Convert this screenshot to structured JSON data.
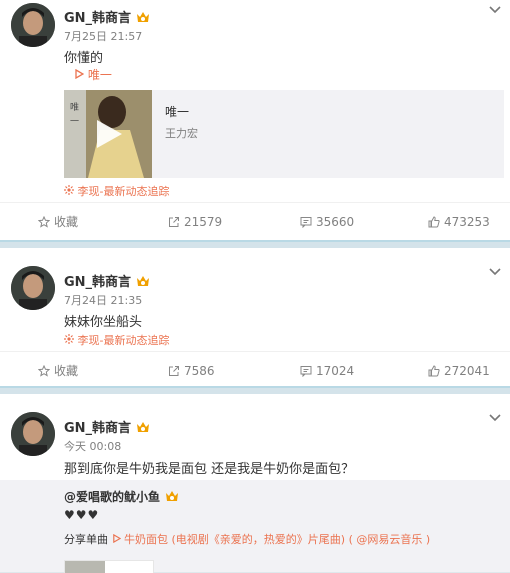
{
  "posts": [
    {
      "username": "GN_韩商言",
      "time": "7月25日 21:57",
      "text": "你懂的",
      "music_link": "唯一",
      "media": {
        "title": "唯一",
        "artist": "王力宏"
      },
      "source": "李现-最新动态追踪",
      "actions": {
        "favorite": "收藏",
        "share": "21579",
        "comment": "35660",
        "like": "473253"
      }
    },
    {
      "username": "GN_韩商言",
      "time": "7月24日 21:35",
      "text": "妹妹你坐船头",
      "source": "李现-最新动态追踪",
      "actions": {
        "favorite": "收藏",
        "share": "7586",
        "comment": "17024",
        "like": "272041"
      }
    },
    {
      "username": "GN_韩商言",
      "time": "今天 00:08",
      "text": "那到底你是牛奶我是面包 还是我是牛奶你是面包？",
      "quote": {
        "username": "@爱唱歌的鱿小鱼",
        "text": "♥♥♥",
        "share_prefix": "分享单曲",
        "song": "牛奶面包 (电视剧《亲爱的，热爱的》片尾曲)",
        "song_source": "( @网易云音乐 )"
      }
    }
  ],
  "colors": {
    "accent": "#eb7350",
    "vip": "#f0a000",
    "muted": "#808080"
  }
}
